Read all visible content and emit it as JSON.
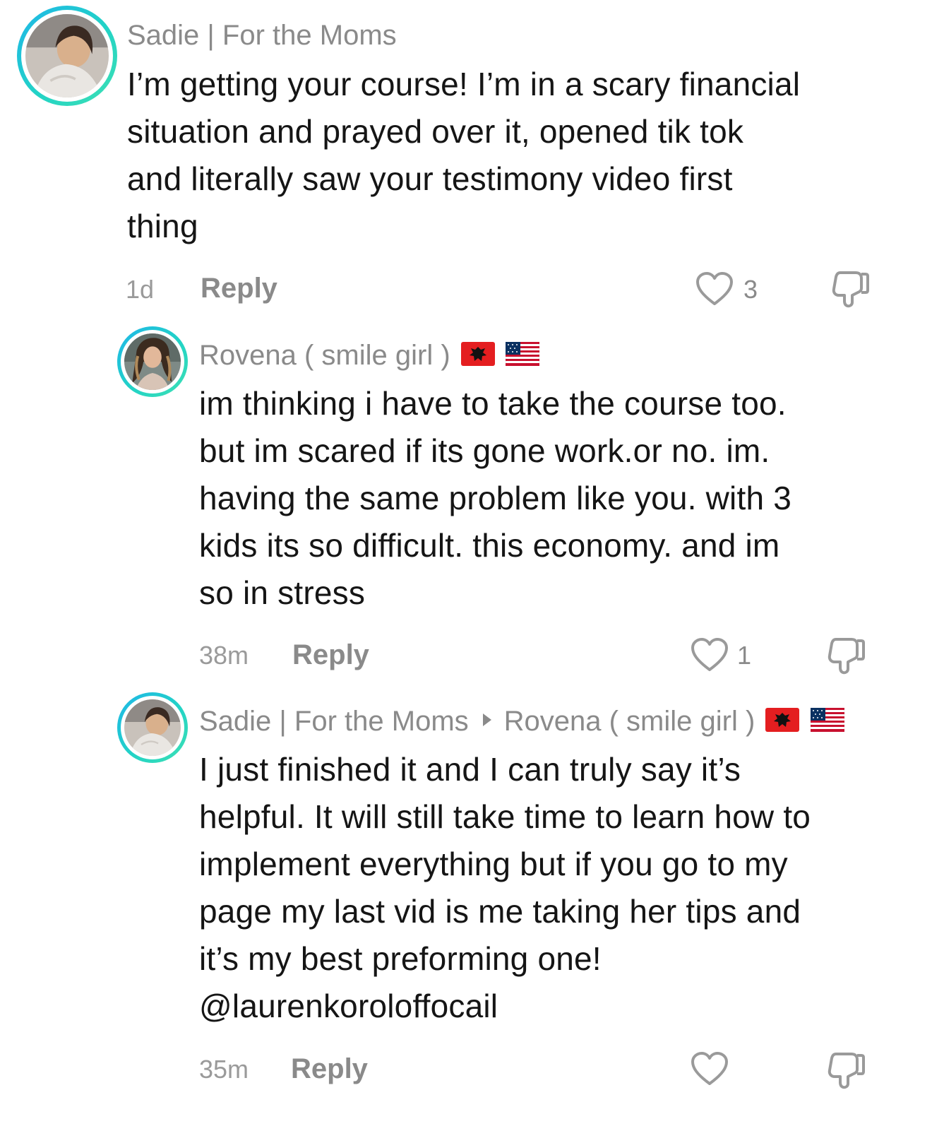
{
  "comments": [
    {
      "username": "Sadie | For the Moms",
      "text_lines": [
        "I’m getting your course! I’m in a scary financial",
        "situation and prayed over it, opened tik tok",
        "and literally saw your testimony video first",
        "thing"
      ],
      "time": "1d",
      "reply_label": "Reply",
      "likes": "3",
      "like_icon": "heart-outline-icon",
      "dislike_icon": "thumbs-down-icon"
    },
    {
      "username": "Rovena ( smile girl )",
      "flags": [
        "albania-flag",
        "usa-flag"
      ],
      "text_lines": [
        "im thinking i have to take the course too.",
        "but im scared if its gone work.or no. im.",
        "having the same problem like you. with 3",
        "kids its so difficult. this economy. and im",
        "so in stress"
      ],
      "time": "38m",
      "reply_label": "Reply",
      "likes": "1",
      "like_icon": "heart-outline-icon",
      "dislike_icon": "thumbs-down-icon"
    },
    {
      "username": "Sadie | For the Moms",
      "reply_to": "Rovena ( smile girl )",
      "flags": [
        "albania-flag",
        "usa-flag"
      ],
      "text_lines": [
        "I just finished it and I can truly say it’s",
        "helpful. It will still take time to learn how to",
        "implement everything but if you go to my",
        "page my last vid is me taking her tips and",
        "it’s my best preforming one!",
        "@laurenkoroloffocail"
      ],
      "time": "35m",
      "reply_label": "Reply",
      "likes": "",
      "like_icon": "heart-outline-icon",
      "dislike_icon": "thumbs-down-icon"
    }
  ],
  "colors": {
    "avatar_ring_start": "#1fb6e8",
    "avatar_ring_end": "#3ee0b3",
    "username": "#8a8a8a",
    "body_text": "#151515",
    "meta": "#9a9a9a"
  }
}
